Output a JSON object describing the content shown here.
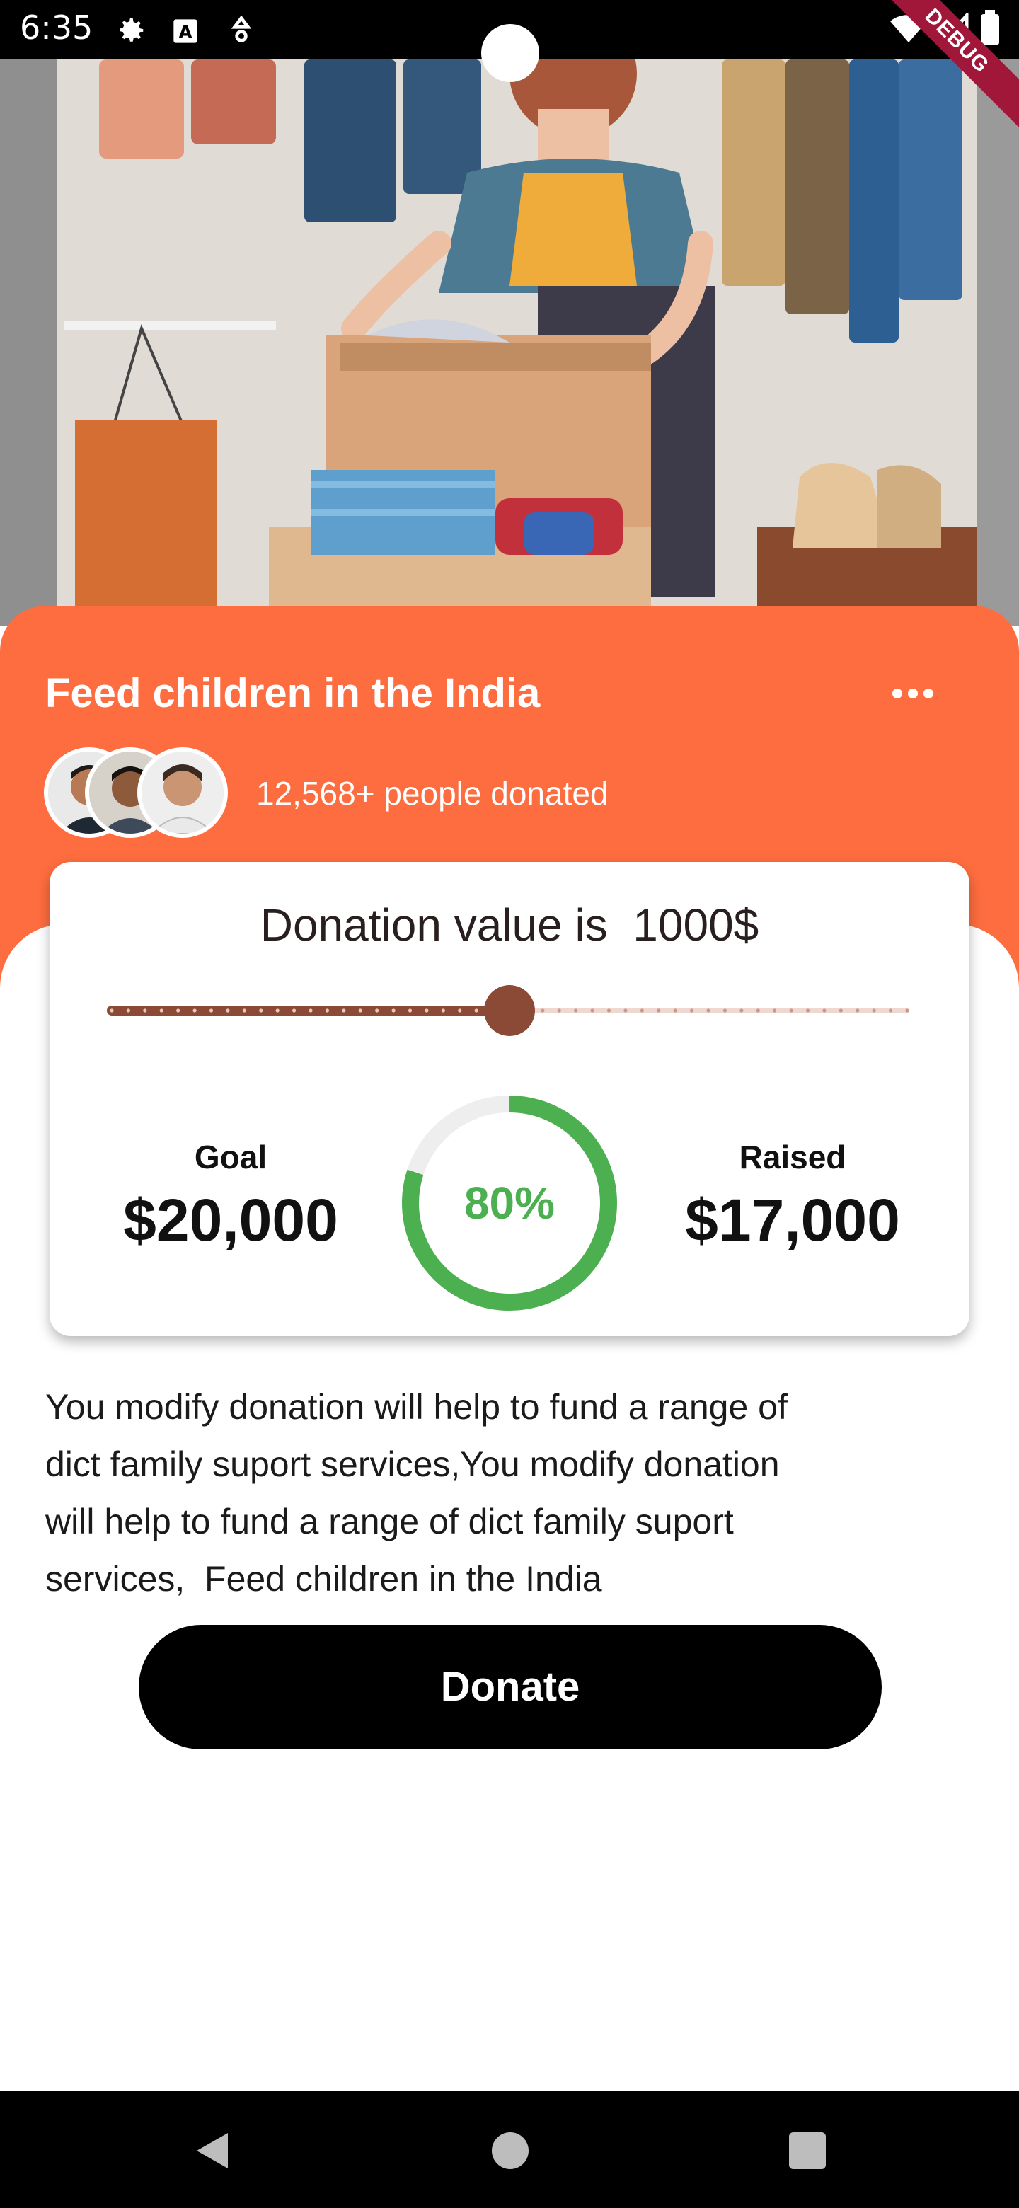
{
  "status_bar": {
    "time": "6:35",
    "icons": [
      "gear-icon",
      "text-box-icon",
      "location-icon",
      "wifi-icon",
      "signal-icon",
      "battery-icon"
    ],
    "debug_banner": "DEBUG"
  },
  "hero": {
    "illustration": "person-packing-clothes-donation-boxes"
  },
  "campaign": {
    "title": "Feed children in the India",
    "menu_icon": "more-horizontal-icon",
    "donated_text": "12,568+ people donated"
  },
  "card": {
    "donation_label": "Donation value is  1000$",
    "slider_fraction": 0.5,
    "goal_label": "Goal",
    "goal_value": "$20,000",
    "raised_label": "Raised",
    "raised_value": "$17,000",
    "progress_text": "80%",
    "progress_fraction": 0.8
  },
  "colors": {
    "accent": "#fe6d3f",
    "slider": "#8b4a35",
    "progress": "#4caf50",
    "button": "#000000"
  },
  "description": "You modify donation will help to fund a range of\ndict family suport services,You modify donation\nwill help to fund a range of dict family suport\nservices,  Feed children in the India",
  "actions": {
    "donate_label": "Donate"
  },
  "nav_bar": {
    "buttons": [
      "back-icon",
      "home-icon",
      "recents-icon"
    ]
  }
}
